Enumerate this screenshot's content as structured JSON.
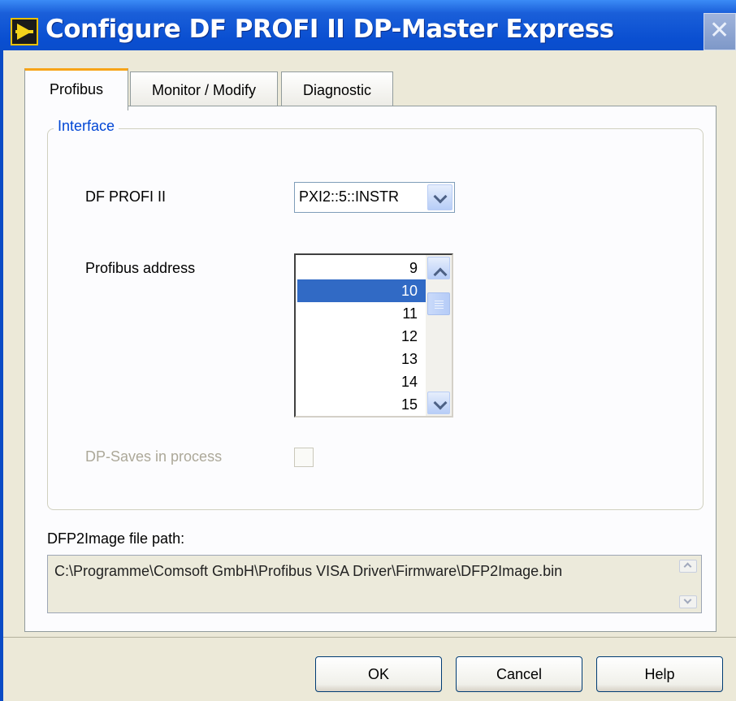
{
  "window": {
    "title": "Configure DF PROFI II DP-Master Express",
    "close_label": "✕"
  },
  "tabs": [
    {
      "label": "Profibus",
      "active": true
    },
    {
      "label": "Monitor / Modify",
      "active": false
    },
    {
      "label": "Diagnostic",
      "active": false
    }
  ],
  "interface_group": {
    "title": "Interface",
    "device_label": "DF PROFI II",
    "device_value": "PXI2::5::INSTR",
    "address_label": "Profibus address",
    "address_items": [
      "9",
      "10",
      "11",
      "12",
      "13",
      "14",
      "15"
    ],
    "address_selected": "10",
    "dp_saves_label": "DP-Saves in process",
    "dp_saves_checked": false
  },
  "file_path": {
    "label": "DFP2Image file path:",
    "value": "C:\\Programme\\Comsoft GmbH\\Profibus VISA Driver\\Firmware\\DFP2Image.bin"
  },
  "buttons": {
    "ok": "OK",
    "cancel": "Cancel",
    "help": "Help"
  },
  "colors": {
    "titlebar": "#0b4bc5",
    "tab_accent": "#f7a418",
    "group_title": "#0046d5",
    "selection": "#316ac5"
  }
}
